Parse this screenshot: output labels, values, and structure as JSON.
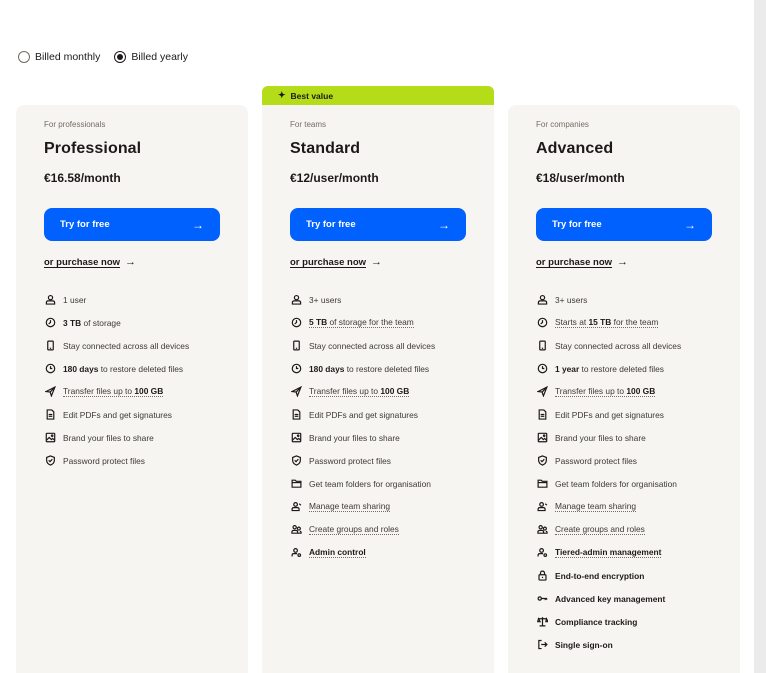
{
  "billing": {
    "monthly_label": "Billed monthly",
    "yearly_label": "Billed yearly",
    "selected": "yearly"
  },
  "plans": [
    {
      "for": "For professionals",
      "name": "Professional",
      "price": "€16.58/month",
      "cta": "Try for free",
      "purchase": "or purchase now",
      "features": [
        {
          "icon": "user-icon",
          "pre": "",
          "bold": "",
          "post": "1 user",
          "dotted": false
        },
        {
          "icon": "clock-icon",
          "pre": "",
          "bold": "3 TB",
          "post": " of storage",
          "dotted": false
        },
        {
          "icon": "device-icon",
          "pre": "",
          "bold": "",
          "post": "Stay connected across all devices",
          "dotted": false
        },
        {
          "icon": "history-icon",
          "pre": "",
          "bold": "180 days",
          "post": " to restore deleted files",
          "dotted": false
        },
        {
          "icon": "send-icon",
          "pre": "Transfer files up to ",
          "bold": "100 GB",
          "post": "",
          "dotted": true
        },
        {
          "icon": "pdf-icon",
          "pre": "",
          "bold": "",
          "post": "Edit PDFs and get signatures",
          "dotted": false
        },
        {
          "icon": "image-icon",
          "pre": "",
          "bold": "",
          "post": "Brand your files to share",
          "dotted": false
        },
        {
          "icon": "shield-icon",
          "pre": "",
          "bold": "",
          "post": "Password protect files",
          "dotted": false
        }
      ]
    },
    {
      "badge": "Best value",
      "for": "For teams",
      "name": "Standard",
      "price": "€12/user/month",
      "cta": "Try for free",
      "purchase": "or purchase now",
      "features": [
        {
          "icon": "user-icon",
          "pre": "",
          "bold": "",
          "post": "3+ users",
          "dotted": false
        },
        {
          "icon": "clock-icon",
          "pre": "",
          "bold": "5 TB",
          "post": " of storage for the team",
          "dotted": true
        },
        {
          "icon": "device-icon",
          "pre": "",
          "bold": "",
          "post": "Stay connected across all devices",
          "dotted": false
        },
        {
          "icon": "history-icon",
          "pre": "",
          "bold": "180 days",
          "post": " to restore deleted files",
          "dotted": false
        },
        {
          "icon": "send-icon",
          "pre": "Transfer files up to ",
          "bold": "100 GB",
          "post": "",
          "dotted": true
        },
        {
          "icon": "pdf-icon",
          "pre": "",
          "bold": "",
          "post": "Edit PDFs and get signatures",
          "dotted": false
        },
        {
          "icon": "image-icon",
          "pre": "",
          "bold": "",
          "post": "Brand your files to share",
          "dotted": false
        },
        {
          "icon": "shield-icon",
          "pre": "",
          "bold": "",
          "post": "Password protect files",
          "dotted": false
        },
        {
          "icon": "folder-icon",
          "pre": "",
          "bold": "",
          "post": "Get team folders for organisation",
          "dotted": false
        },
        {
          "icon": "team-share-icon",
          "pre": "",
          "bold": "",
          "post": "Manage team sharing",
          "dotted": true
        },
        {
          "icon": "group-icon",
          "pre": "",
          "bold": "",
          "post": "Create groups and roles",
          "dotted": true
        },
        {
          "icon": "admin-icon",
          "pre": "",
          "bold": "Admin control",
          "post": "",
          "dotted": true
        }
      ]
    },
    {
      "for": "For companies",
      "name": "Advanced",
      "price": "€18/user/month",
      "cta": "Try for free",
      "purchase": "or purchase now",
      "features": [
        {
          "icon": "user-icon",
          "pre": "",
          "bold": "",
          "post": "3+ users",
          "dotted": false
        },
        {
          "icon": "clock-icon",
          "pre": "Starts at ",
          "bold": "15 TB",
          "post": " for the team",
          "dotted": true
        },
        {
          "icon": "device-icon",
          "pre": "",
          "bold": "",
          "post": "Stay connected across all devices",
          "dotted": false
        },
        {
          "icon": "history-icon",
          "pre": "",
          "bold": "1 year",
          "post": " to restore deleted files",
          "dotted": false
        },
        {
          "icon": "send-icon",
          "pre": "Transfer files up to ",
          "bold": "100 GB",
          "post": "",
          "dotted": true
        },
        {
          "icon": "pdf-icon",
          "pre": "",
          "bold": "",
          "post": "Edit PDFs and get signatures",
          "dotted": false
        },
        {
          "icon": "image-icon",
          "pre": "",
          "bold": "",
          "post": "Brand your files to share",
          "dotted": false
        },
        {
          "icon": "shield-icon",
          "pre": "",
          "bold": "",
          "post": "Password protect files",
          "dotted": false
        },
        {
          "icon": "folder-icon",
          "pre": "",
          "bold": "",
          "post": "Get team folders for organisation",
          "dotted": false
        },
        {
          "icon": "team-share-icon",
          "pre": "",
          "bold": "",
          "post": "Manage team sharing",
          "dotted": true
        },
        {
          "icon": "group-icon",
          "pre": "",
          "bold": "",
          "post": "Create groups and roles",
          "dotted": true
        },
        {
          "icon": "admin-icon",
          "pre": "",
          "bold": "Tiered-admin management",
          "post": "",
          "dotted": true
        },
        {
          "icon": "lock-icon",
          "pre": "",
          "bold": "End-to-end encryption",
          "post": "",
          "dotted": false
        },
        {
          "icon": "key-icon",
          "pre": "",
          "bold": "Advanced key management",
          "post": "",
          "dotted": false
        },
        {
          "icon": "scale-icon",
          "pre": "",
          "bold": "Compliance tracking",
          "post": "",
          "dotted": false
        },
        {
          "icon": "signin-icon",
          "pre": "",
          "bold": "Single sign-on",
          "post": "",
          "dotted": false
        }
      ]
    }
  ],
  "colors": {
    "accent": "#0061fe",
    "badge": "#b4dc19",
    "card_bg": "#f7f5f2",
    "text": "#1e1919"
  }
}
